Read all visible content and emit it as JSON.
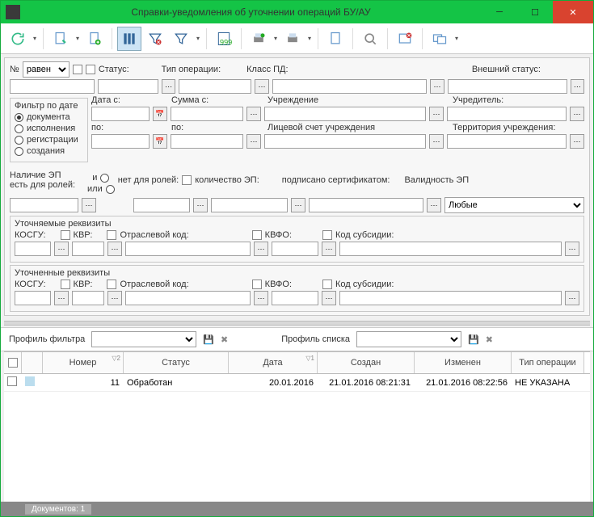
{
  "window": {
    "title": "Справки-уведомления об уточнении операций БУ/АУ"
  },
  "filters": {
    "numberOp": "равен",
    "statusLabel": "Статус:",
    "opTypeLabel": "Тип операции:",
    "classPDLabel": "Класс ПД:",
    "externalStatusLabel": "Внешний статус:",
    "dateFilter": {
      "title": "Фильтр по дате",
      "options": [
        "документа",
        "исполнения",
        "регистрации",
        "создания"
      ],
      "selected": 0
    },
    "dateFromLabel": "Дата с:",
    "dateToLabel": "по:",
    "sumFromLabel": "Сумма с:",
    "sumToLabel": "по:",
    "institutionLabel": "Учреждение",
    "founderLabel": "Учредитель:",
    "accountLabel": "Лицевой счет учреждения",
    "territoryLabel": "Территория учреждения:",
    "ep": {
      "title": "Наличие ЭП",
      "hasRolesLabel": "есть для ролей:",
      "and": "и",
      "or": "или",
      "noRolesLabel": "нет для ролей:",
      "countLabel": "количество ЭП:",
      "signedLabel": "подписано сертификатом:",
      "validityLabel": "Валидность ЭП",
      "validityValue": "Любые"
    },
    "g1": {
      "title": "Уточняемые реквизиты",
      "kosgu": "КОСГУ:",
      "kvr": "КВР:",
      "otrasl": "Отраслевой код:",
      "kvfo": "КВФО:",
      "subsidy": "Код субсидии:"
    },
    "g2": {
      "title": "Уточненные реквизиты",
      "kosgu": "КОСГУ:",
      "kvr": "КВР:",
      "otrasl": "Отраслевой код:",
      "kvfo": "КВФО:",
      "subsidy": "Код субсидии:"
    }
  },
  "profiles": {
    "filterLabel": "Профиль фильтра",
    "listLabel": "Профиль списка"
  },
  "grid": {
    "columns": [
      "",
      "",
      "Номер",
      "Статус",
      "Дата",
      "Создан",
      "Изменен",
      "Тип операции"
    ],
    "sortMarks": [
      "",
      "",
      "▽2",
      "",
      "▽1",
      "",
      "",
      ""
    ],
    "rows": [
      {
        "cells": [
          "",
          "",
          "11",
          "Обработан",
          "20.01.2016",
          "21.01.2016 08:21:31",
          "21.01.2016 08:22:56",
          "НЕ УКАЗАНА"
        ]
      }
    ]
  },
  "status": {
    "docs": "Документов: 1"
  }
}
